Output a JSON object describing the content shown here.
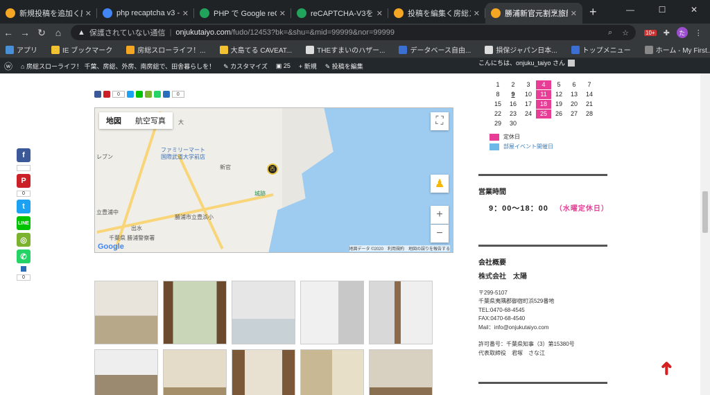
{
  "browser": {
    "tabs": [
      {
        "title": "新規投稿を追加く房総",
        "color": "#f5a623"
      },
      {
        "title": "php recaptcha v3 - G",
        "color": "#4285f4"
      },
      {
        "title": "PHP で Google reCAPT",
        "color": "#21a35b"
      },
      {
        "title": "reCAPTCHA-V3をPH",
        "color": "#21a35b"
      },
      {
        "title": "投稿を編集く房総ス",
        "color": "#f5a623"
      },
      {
        "title": "勝浦新官元割烹旅館",
        "color": "#f5a623"
      }
    ],
    "new_tab": "+",
    "url_warning": "保護されていない通信",
    "url_host": "onjukutaiyo.com",
    "url_path": "/fudo/12453?bk=&shu=&mid=99999&nor=99999",
    "ext_badge": "10+",
    "avatar": "た"
  },
  "bookmarks": [
    {
      "label": "アプリ",
      "color": "#4a90d9"
    },
    {
      "label": "IE ブックマーク",
      "color": "#f2c230"
    },
    {
      "label": "房総スローライフ！...",
      "color": "#f5a623"
    },
    {
      "label": "大島てる CAVEAT...",
      "color": "#f2c230"
    },
    {
      "label": "THEすまいのハザー...",
      "color": "#dddddd"
    },
    {
      "label": "データベース自由...",
      "color": "#3b6fd1"
    },
    {
      "label": "損保ジャパン日本...",
      "color": "#dddddd"
    },
    {
      "label": "トップメニュー",
      "color": "#3b6fd1"
    },
    {
      "label": "ホーム - My First...",
      "color": "#888888"
    }
  ],
  "wp": {
    "site": "房総スローライフ！ 千葉、房総、外房、南房総で、田舎暮らしを！",
    "customize": "カスタマイズ",
    "comments": "25",
    "new": "新規",
    "edit": "投稿を編集",
    "greeting": "こんにちは、onjuku_taiyo さん"
  },
  "share": {
    "count_fb": "0",
    "count_pin": "0",
    "count_last": "0",
    "side_counts": [
      "",
      "0",
      "0"
    ]
  },
  "map": {
    "btn_map": "地図",
    "btn_sat": "航空写真",
    "labels": [
      "ファミリーマート",
      "国際武道大学前店",
      "新官",
      "城跡",
      "勝浦市立豊浜小",
      "千葉県 勝浦警察署",
      "出水",
      "立豊浦中",
      "レブン",
      "大"
    ],
    "zoom_in": "+",
    "zoom_out": "−",
    "footer": [
      "地図データ ©2020",
      "利用規約",
      "地図の誤りを報告する"
    ],
    "google": "Google"
  },
  "calendar": {
    "days": [
      "1",
      "2",
      "3",
      "4",
      "5",
      "6",
      "7",
      "8",
      "9",
      "10",
      "11",
      "12",
      "13",
      "14",
      "15",
      "16",
      "17",
      "18",
      "19",
      "20",
      "21",
      "22",
      "23",
      "24",
      "25",
      "26",
      "27",
      "28",
      "29",
      "30"
    ],
    "holidays": [
      "4",
      "11",
      "18",
      "25"
    ],
    "holiday_color": "#e83d97",
    "event_color": "#6cb8e8",
    "legend_holiday": "定休日",
    "legend_event": "部屋イベント開催日"
  },
  "hours": {
    "title": "営業時間",
    "time": "9：00〜18：00",
    "closed": "（水曜定休日）"
  },
  "company": {
    "title": "会社概要",
    "name": "株式会社　太陽",
    "lines": [
      "〒299-5107",
      "千葉県夷隅郡御宿町浜529番地",
      "TEL:0470-68-4545",
      "FAX:0470-68-4540",
      "Mail：info@onjukutaiyo.com",
      "",
      "許可番号：千葉県知事（3）第15380号",
      "代表取締役　君塚　さな江"
    ]
  },
  "to_top": "➜"
}
